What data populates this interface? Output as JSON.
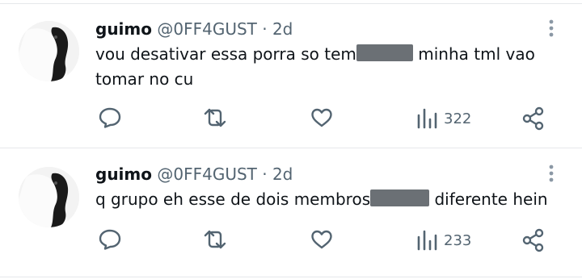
{
  "posts": [
    {
      "display_name": "guimo",
      "handle": "@0FF4GUST",
      "separator": "·",
      "time": "2d",
      "text_before": "vou desativar essa porra so tem",
      "text_after": " minha tml vao tomar no cu",
      "views": "322"
    },
    {
      "display_name": "guimo",
      "handle": "@0FF4GUST",
      "separator": "·",
      "time": "2d",
      "text_before": "q grupo eh esse de dois membros",
      "text_after": " diferente hein",
      "views": "233"
    }
  ],
  "icons": {
    "reply": "speech-bubble-icon",
    "repost": "repost-arrows-icon",
    "like": "heart-icon",
    "views": "bar-chart-icon",
    "share": "share-icon",
    "more": "vertical-dots-icon"
  },
  "colors": {
    "text": "#0f1419",
    "secondary": "#536471",
    "divider": "#e6e8eb",
    "redaction": "#6b7075"
  }
}
